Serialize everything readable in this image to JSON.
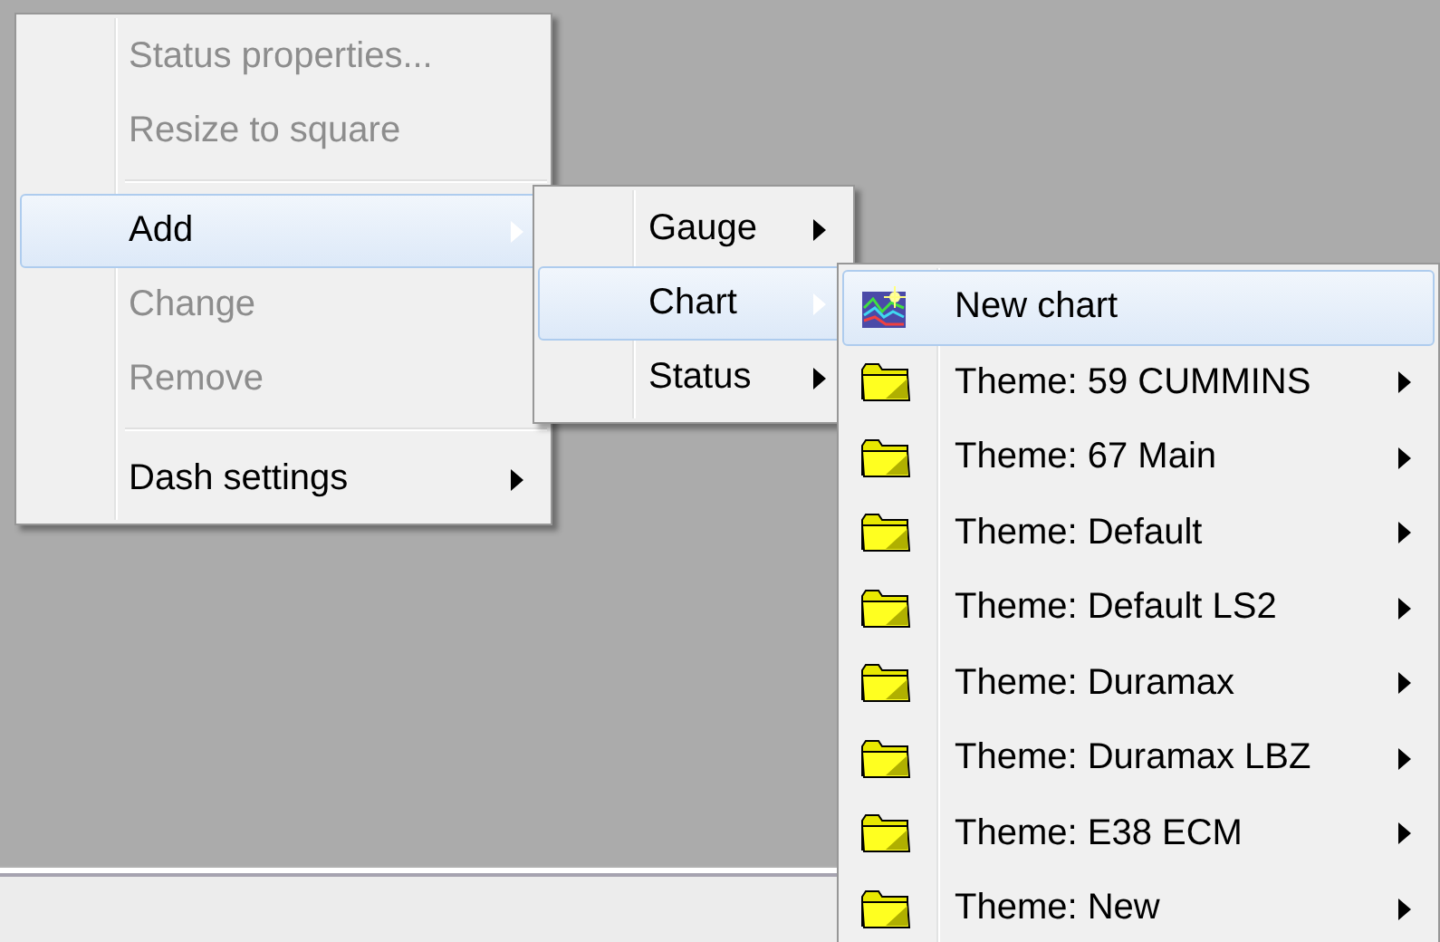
{
  "menus": [
    {
      "items": [
        {
          "kind": "text",
          "label": "Status properties...",
          "disabled": true,
          "selected": false,
          "has_submenu": false
        },
        {
          "kind": "text",
          "label": "Resize to square",
          "disabled": true,
          "selected": false,
          "has_submenu": false
        },
        {
          "kind": "separator"
        },
        {
          "kind": "text",
          "label": "Add",
          "disabled": false,
          "selected": true,
          "has_submenu": true
        },
        {
          "kind": "text",
          "label": "Change",
          "disabled": true,
          "selected": false,
          "has_submenu": false
        },
        {
          "kind": "text",
          "label": "Remove",
          "disabled": true,
          "selected": false,
          "has_submenu": false
        },
        {
          "kind": "separator"
        },
        {
          "kind": "text",
          "label": "Dash settings",
          "disabled": false,
          "selected": false,
          "has_submenu": true
        }
      ]
    },
    {
      "items": [
        {
          "kind": "text",
          "label": "Gauge",
          "disabled": false,
          "selected": false,
          "has_submenu": true
        },
        {
          "kind": "text",
          "label": "Chart",
          "disabled": false,
          "selected": true,
          "has_submenu": true
        },
        {
          "kind": "text",
          "label": "Status",
          "disabled": false,
          "selected": false,
          "has_submenu": true
        }
      ]
    },
    {
      "items": [
        {
          "kind": "chart",
          "label": "New chart",
          "disabled": false,
          "selected": true,
          "has_submenu": false
        },
        {
          "kind": "folder",
          "label": "Theme: 59 CUMMINS",
          "disabled": false,
          "selected": false,
          "has_submenu": true
        },
        {
          "kind": "folder",
          "label": "Theme: 67 Main",
          "disabled": false,
          "selected": false,
          "has_submenu": true
        },
        {
          "kind": "folder",
          "label": "Theme: Default",
          "disabled": false,
          "selected": false,
          "has_submenu": true
        },
        {
          "kind": "folder",
          "label": "Theme: Default LS2",
          "disabled": false,
          "selected": false,
          "has_submenu": true
        },
        {
          "kind": "folder",
          "label": "Theme: Duramax",
          "disabled": false,
          "selected": false,
          "has_submenu": true
        },
        {
          "kind": "folder",
          "label": "Theme: Duramax LBZ",
          "disabled": false,
          "selected": false,
          "has_submenu": true
        },
        {
          "kind": "folder",
          "label": "Theme: E38 ECM",
          "disabled": false,
          "selected": false,
          "has_submenu": true
        },
        {
          "kind": "folder",
          "label": "Theme: New",
          "disabled": false,
          "selected": false,
          "has_submenu": true
        }
      ]
    }
  ]
}
